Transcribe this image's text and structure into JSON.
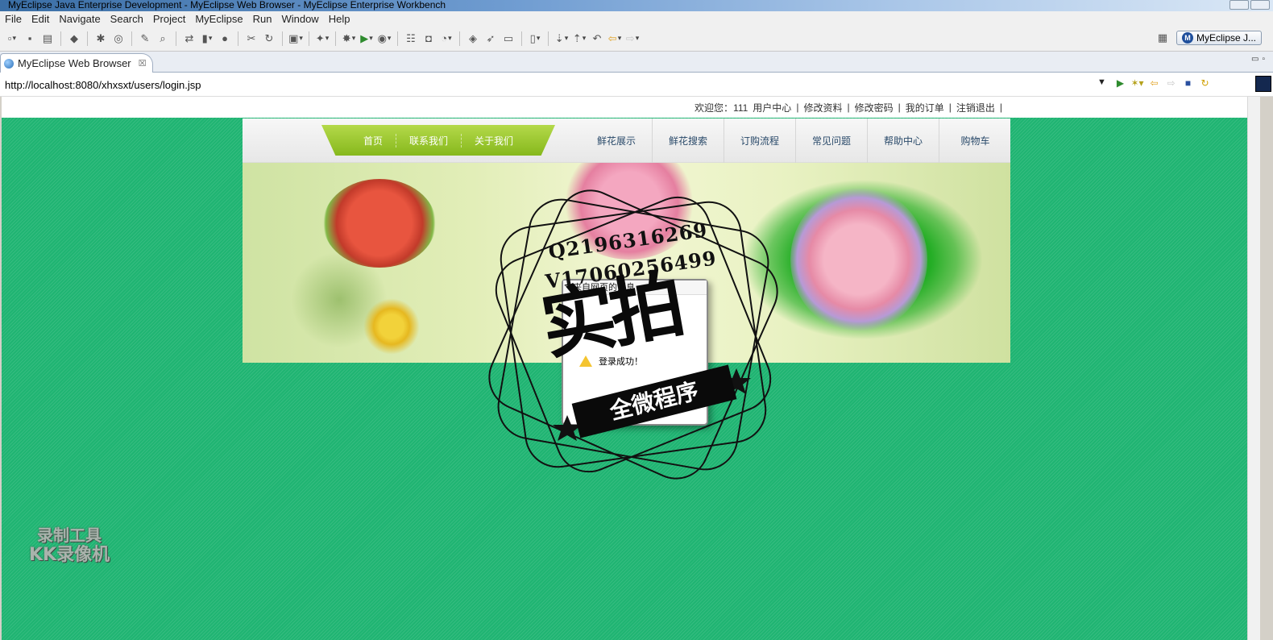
{
  "window": {
    "title": "MyEclipse Java Enterprise Development - MyEclipse Web Browser - MyEclipse Enterprise Workbench"
  },
  "menu": [
    "File",
    "Edit",
    "Navigate",
    "Search",
    "Project",
    "MyEclipse",
    "Run",
    "Window",
    "Help"
  ],
  "toolbar": {
    "perspective_label": "MyEclipse J...",
    "perspective_icon_letter": "M"
  },
  "editor_tab": {
    "label": "MyEclipse Web Browser",
    "close": "☒"
  },
  "browser": {
    "url": "http://localhost:8080/xhxsxt/users/login.jsp"
  },
  "site": {
    "welcome_prefix": "欢迎您：",
    "username": "111",
    "top_links": [
      "用户中心",
      "修改资料",
      "修改密码",
      "我的订单",
      "注销退出"
    ],
    "link_separator": "|",
    "nav_green": [
      "首页",
      "联系我们",
      "关于我们"
    ],
    "nav_right": [
      "鲜花展示",
      "鲜花搜索",
      "订购流程",
      "常见问题",
      "帮助中心",
      "购物车"
    ]
  },
  "dialog": {
    "title": "来自网页的消息",
    "message": "登录成功！"
  },
  "watermark": {
    "line1": "Q2196316269",
    "line2": "V17060256499",
    "big": "实拍",
    "ribbon": "全微程序",
    "recorder_line1": "录制工具",
    "recorder_line2": "KK录像机"
  }
}
